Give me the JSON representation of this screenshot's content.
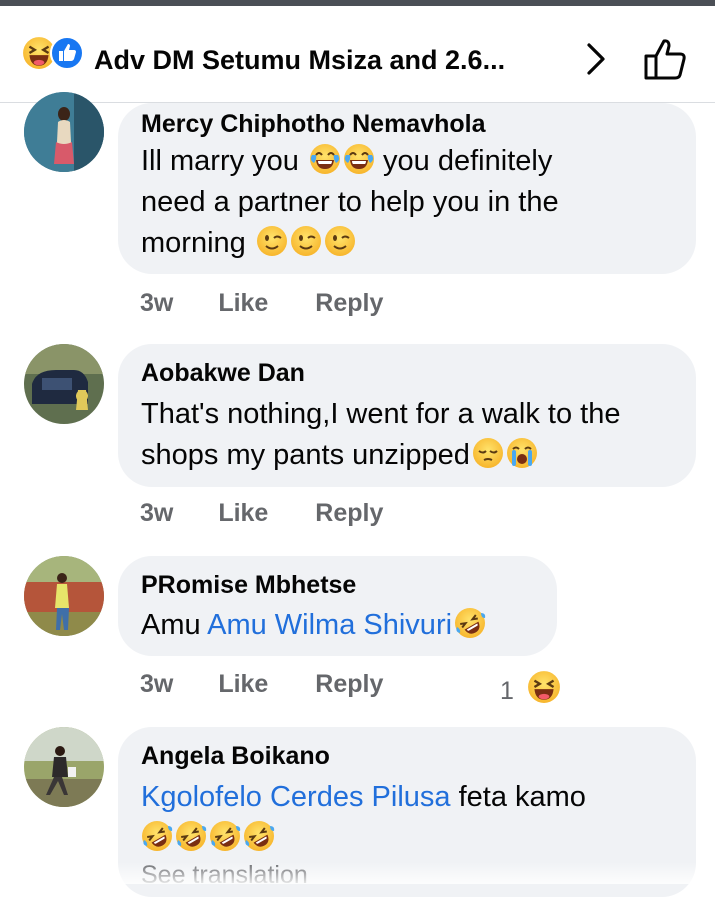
{
  "header": {
    "title": "Adv DM Setumu Msiza and 2.6...",
    "reaction_icons": [
      "haha-icon",
      "like-icon"
    ]
  },
  "comments": [
    {
      "author": "Mercy Chiphotho Nemavhola",
      "lines": [
        "Ill marry you",
        "you definitely",
        "need a partner to help you in the",
        "morning"
      ],
      "emojis": [
        "tears-of-joy",
        "tears-of-joy",
        "winking",
        "winking",
        "winking"
      ],
      "time": "3w",
      "like": "Like",
      "reply": "Reply"
    },
    {
      "author": "Aobakwe Dan",
      "lines": [
        "That's nothing,I went for a walk to the",
        "shops my pants unzipped"
      ],
      "emojis": [
        "pensive",
        "loudly-crying"
      ],
      "time": "3w",
      "like": "Like",
      "reply": "Reply"
    },
    {
      "author": "PRomise Mbhetse",
      "text_prefix": "Amu",
      "mention": "Amu Wilma Shivuri",
      "emojis": [
        "rolling-laughing"
      ],
      "time": "3w",
      "like": "Like",
      "reply": "Reply",
      "reaction_count": "1",
      "reaction_icon": "haha-icon"
    },
    {
      "author": "Angela Boikano",
      "mention": "Kgolofelo Cerdes Pilusa",
      "text_suffix": "feta kamo",
      "emojis": [
        "rolling-laughing",
        "rolling-laughing",
        "rolling-laughing",
        "rolling-laughing"
      ],
      "see_translation": "See translation"
    }
  ],
  "colors": {
    "bubble": "#f0f2f5",
    "mention": "#216fdb",
    "meta": "#65676b",
    "like_blue": "#1877f2"
  }
}
